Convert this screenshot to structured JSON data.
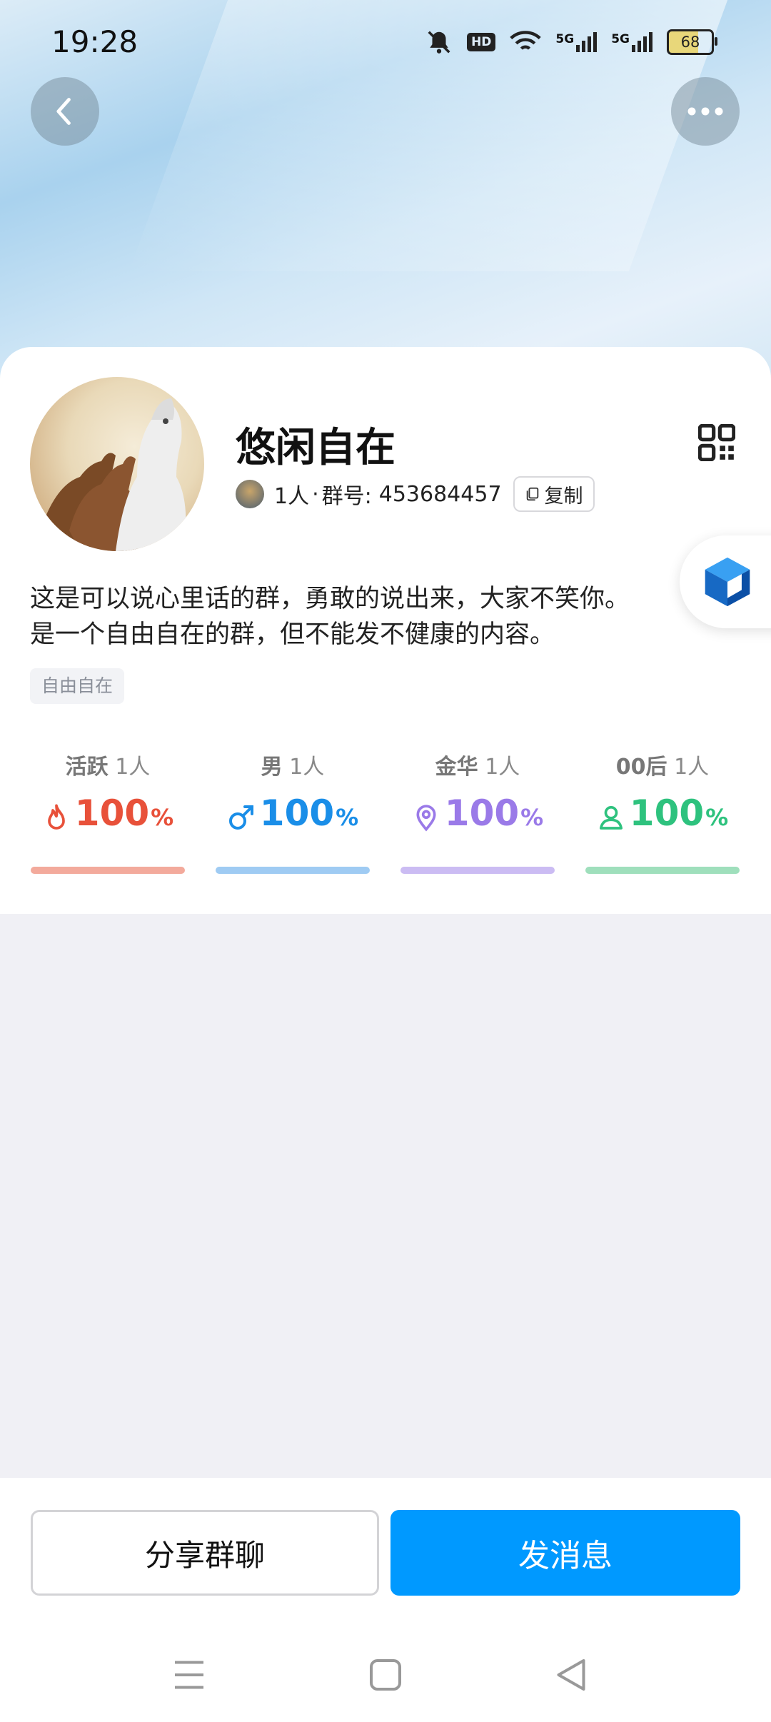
{
  "status_bar": {
    "time": "19:28",
    "hd_label": "HD",
    "signal1_label": "5G",
    "signal2_label": "5G",
    "battery": "68"
  },
  "header": {
    "back_icon": "chevron-left-icon",
    "more_icon": "more-dots-icon"
  },
  "group": {
    "name": "悠闲自在",
    "member_count": "1人",
    "separator": "·",
    "id_label": "群号:",
    "id": "453684457",
    "copy_label": "复制",
    "description": "这是可以说心里话的群，勇敢的说出来，大家不笑你。\n是一个自由自在的群，但不能发不健康的内容。",
    "tag": "自由自在"
  },
  "stats": [
    {
      "label": "活跃",
      "count": "1人",
      "value": "100",
      "unit": "%",
      "icon": "fire-icon",
      "color": "#e8513a",
      "bar_color": "#f3aa9c"
    },
    {
      "label": "男",
      "count": "1人",
      "value": "100",
      "unit": "%",
      "icon": "male-icon",
      "color": "#1a8ee8",
      "bar_color": "#9fcbf3"
    },
    {
      "label": "金华",
      "count": "1人",
      "value": "100",
      "unit": "%",
      "icon": "location-pin-icon",
      "color": "#9a7ae8",
      "bar_color": "#cbbcf3"
    },
    {
      "label": "00后",
      "count": "1人",
      "value": "100",
      "unit": "%",
      "icon": "person-icon",
      "color": "#2ec27e",
      "bar_color": "#9fdfbc"
    }
  ],
  "actions": {
    "share_label": "分享群聊",
    "send_label": "发消息"
  },
  "colors": {
    "accent": "#0099ff"
  }
}
